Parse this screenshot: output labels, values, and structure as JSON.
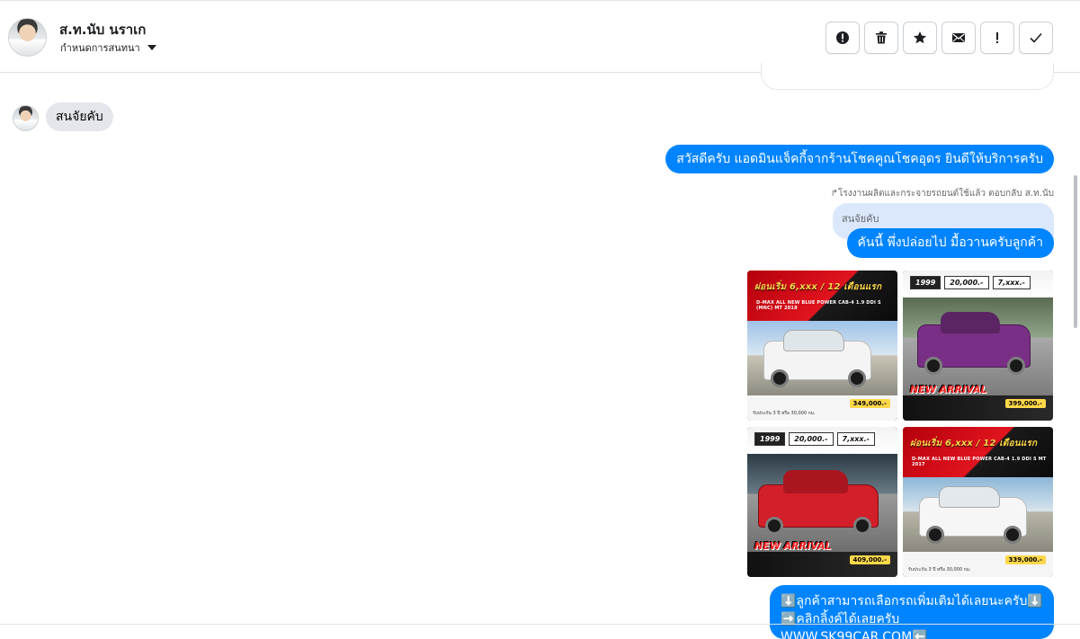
{
  "contact": {
    "name": "ส.ท.นับ นราเก",
    "status_label": "กำหนดการสนทนา"
  },
  "toolbar": [
    {
      "icon": "alert-circle-icon",
      "label": "Mark as spam"
    },
    {
      "icon": "trash-icon",
      "label": "Delete"
    },
    {
      "icon": "star-icon",
      "label": "Follow up"
    },
    {
      "icon": "envelope-icon",
      "label": "Mark as unread"
    },
    {
      "icon": "exclamation-icon",
      "label": "Priority"
    },
    {
      "icon": "check-icon",
      "label": "Mark as done"
    }
  ],
  "messages": {
    "incoming_1": "สนจัยคับ",
    "outgoing_1": "สวัสดีครับ แอดมินแจ็คกี้จากร้านโชคคูณโชคอุดร ยินดีให้บริการครับ",
    "reply_meta": "↱โรงงานผลิตและกระจายรถยนต์ใช้แล้ว ตอบกลับ ส.ท.นับ",
    "reply_quote": "สนจัยคับ",
    "outgoing_2": "คันนี้ พึ่งปล่อยไป มื้อวานครับลูกค้า",
    "outgoing_bottom_line1": "⬇️ลูกค้าสามารถเลือกรถเพิ่มเติมได้เลยนะครับ⬇️",
    "outgoing_bottom_line2": "➡️คลิกลิ้งค์ได้เลยครับ WWW.SK99CAR.COM⬅️"
  },
  "car_ads": [
    {
      "headline": "ผ่อนเริ่ม 6,xxx / 12 เดือนแรก",
      "model": "D-MAX ALL NEW BLUE POWER CAB-4 1.9 DDI S (MNC) MT 2018",
      "price": "349,000.-",
      "note": "รับประกัน 3 ปี หรือ 30,000 กม."
    },
    {
      "year": "1999",
      "down": "20,000.-",
      "installment": "7,xxx.-",
      "banner": "NEW ARRIVAL",
      "price": "399,000.-"
    },
    {
      "year": "1999",
      "down": "20,000.-",
      "installment": "7,xxx.-",
      "banner": "NEW ARRIVAL",
      "price": "409,000.-"
    },
    {
      "headline": "ผ่อนเริ่ม 6,xxx / 12 เดือนแรก",
      "model": "D-MAX ALL NEW BLUE POWER CAB-4 1.9 DDI S MT 2017",
      "price": "339,000.-",
      "note": "รับประกัน 3 ปี หรือ 30,000 กม."
    }
  ],
  "colors": {
    "accent": "#0084ff",
    "incoming_bubble": "#e4e6eb",
    "quote_bubble": "#dbe8fc"
  }
}
